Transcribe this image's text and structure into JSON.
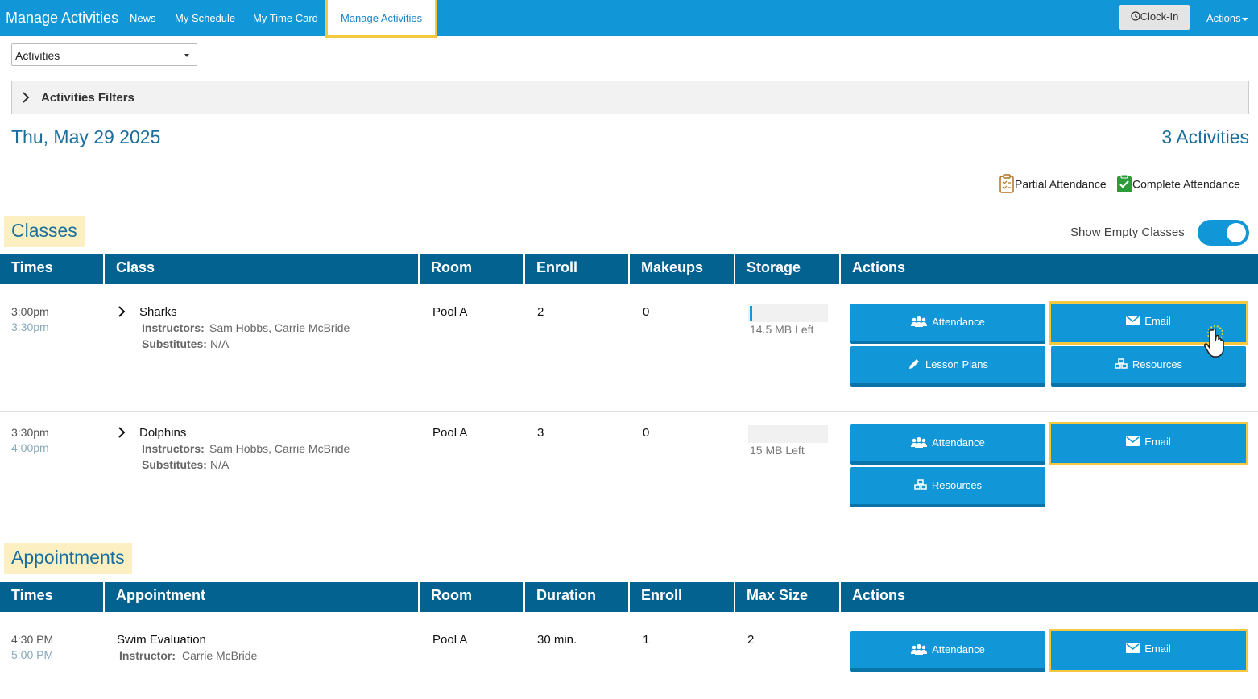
{
  "nav": {
    "brand": "Manage Activities",
    "links": [
      "News",
      "My Schedule",
      "My Time Card",
      "Manage Activities"
    ],
    "clock_in": "Clock-In",
    "actions": "Actions"
  },
  "view_select": "Activities",
  "filters_title": "Activities Filters",
  "date": "Thu, May 29 2025",
  "activity_count": "3 Activities",
  "legend": {
    "partial": "Partial Attendance",
    "complete": "Complete Attendance"
  },
  "classes": {
    "title": "Classes",
    "show_empty_label": "Show Empty Classes",
    "show_empty_on": true,
    "headers": [
      "Times",
      "Class",
      "Room",
      "Enroll",
      "Makeups",
      "Storage",
      "Actions"
    ],
    "rows": [
      {
        "start": "3:00pm",
        "end": "3:30pm",
        "name": "Sharks",
        "instructors_label": "Instructors:",
        "instructors": "Sam Hobbs, Carrie McBride",
        "subs_label": "Substitutes:",
        "subs": "N/A",
        "room": "Pool A",
        "enroll": "2",
        "makeups": "0",
        "storage": "14.5 MB Left",
        "storage_used": 0.03,
        "buttons": [
          "Attendance",
          "Email",
          "Lesson Plans",
          "Resources"
        ]
      },
      {
        "start": "3:30pm",
        "end": "4:00pm",
        "name": "Dolphins",
        "instructors_label": "Instructors:",
        "instructors": "Sam Hobbs, Carrie McBride",
        "subs_label": "Substitutes:",
        "subs": "N/A",
        "room": "Pool A",
        "enroll": "3",
        "makeups": "0",
        "storage": "15 MB Left",
        "storage_used": 0,
        "buttons": [
          "Attendance",
          "Email",
          "Resources"
        ]
      }
    ]
  },
  "appointments": {
    "title": "Appointments",
    "headers": [
      "Times",
      "Appointment",
      "Room",
      "Duration",
      "Enroll",
      "Max Size",
      "Actions"
    ],
    "rows": [
      {
        "start": "4:30 PM",
        "end": "5:00 PM",
        "name": "Swim Evaluation",
        "instructor_label": "Instructor:",
        "instructor": "Carrie McBride",
        "room": "Pool A",
        "duration": "30 min.",
        "enroll": "1",
        "max_size": "2",
        "buttons": [
          "Attendance",
          "Email"
        ]
      }
    ]
  },
  "colors": {
    "primary": "#1196d8",
    "header": "#046291",
    "highlight": "#f5c842",
    "title": "#1a6e9e"
  }
}
